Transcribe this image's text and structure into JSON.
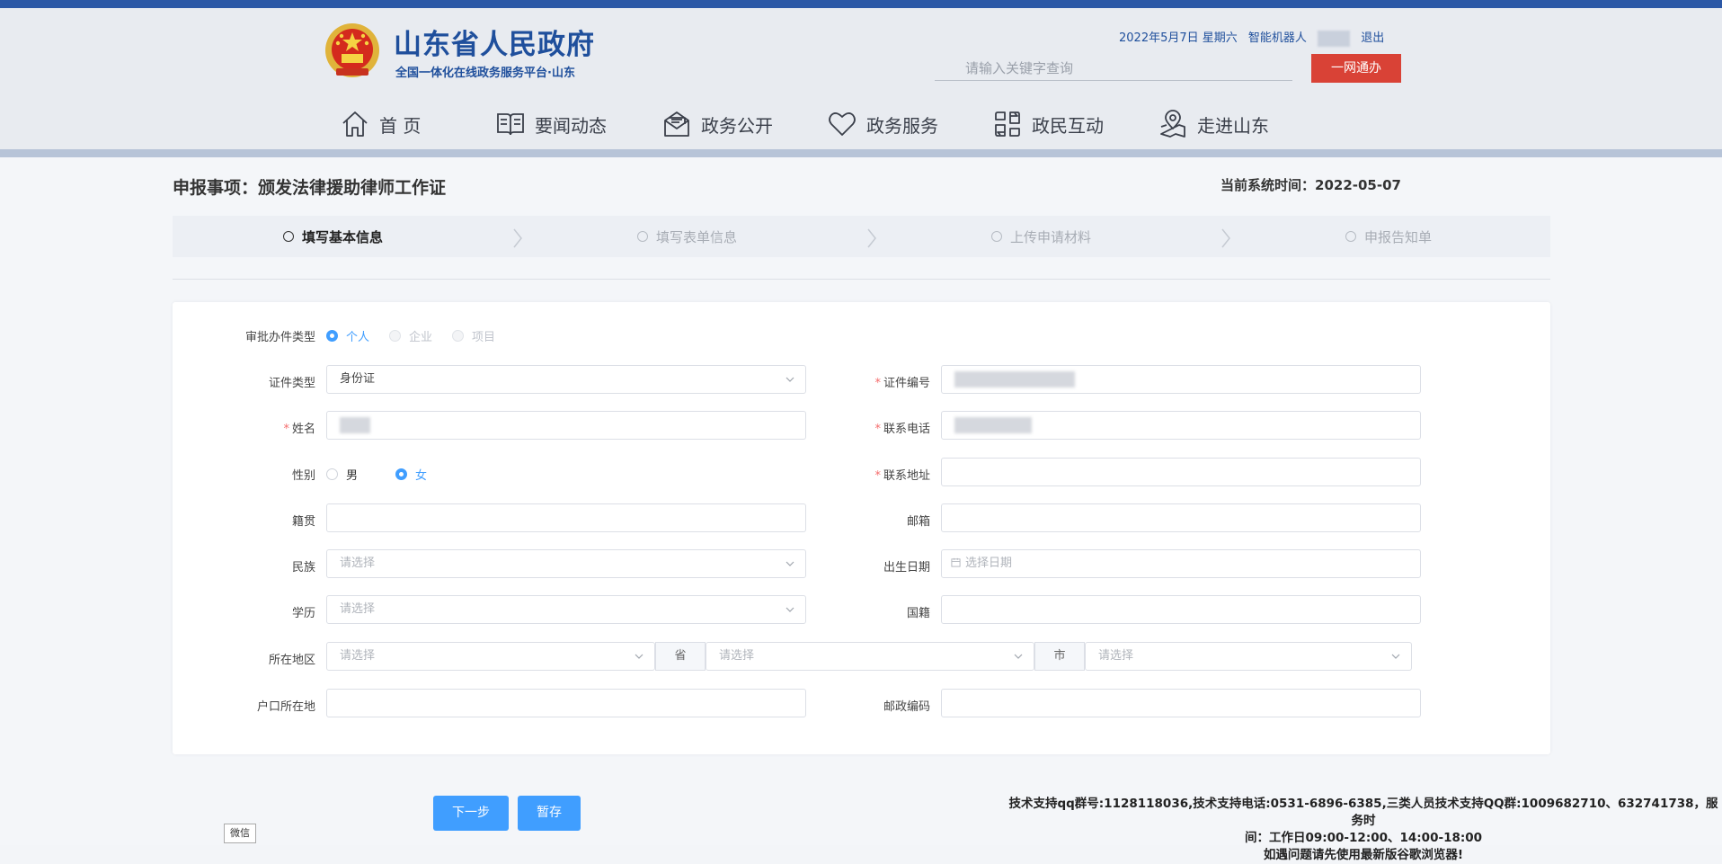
{
  "header": {
    "site_title": "山东省人民政府",
    "site_subtitle": "全国一体化在线政务服务平台·山东",
    "date": "2022年5月7日 星期六",
    "user_label": "智能机器人",
    "logout": "退出",
    "search_placeholder": "请输入关键字查询",
    "yiwang_button": "一网通办"
  },
  "nav": [
    {
      "label": "首 页",
      "icon": "home-icon"
    },
    {
      "label": "要闻动态",
      "icon": "book-icon"
    },
    {
      "label": "政务公开",
      "icon": "mail-icon"
    },
    {
      "label": "政务服务",
      "icon": "heart-icon"
    },
    {
      "label": "政民互动",
      "icon": "exchange-icon"
    },
    {
      "label": "走进山东",
      "icon": "map-pin-icon"
    }
  ],
  "page": {
    "apply_title": "申报事项：颁发法律援助律师工作证",
    "systime_label": "当前系统时间：",
    "systime_value": "2022-05-07"
  },
  "steps": [
    {
      "label": "填写基本信息",
      "active": true
    },
    {
      "label": "填写表单信息",
      "active": false
    },
    {
      "label": "上传申请材料",
      "active": false
    },
    {
      "label": "申报告知单",
      "active": false
    }
  ],
  "form": {
    "type_label": "审批办件类型",
    "type_options": [
      "个人",
      "企业",
      "项目"
    ],
    "id_type_label": "证件类型",
    "id_type_value": "身份证",
    "id_number_label": "证件编号",
    "name_label": "姓名",
    "phone_label": "联系电话",
    "gender_label": "性别",
    "gender_options": [
      "男",
      "女"
    ],
    "address_label": "联系地址",
    "native_label": "籍贯",
    "email_label": "邮箱",
    "ethnicity_label": "民族",
    "ethnicity_placeholder": "请选择",
    "birth_label": "出生日期",
    "birth_placeholder": "选择日期",
    "education_label": "学历",
    "education_placeholder": "请选择",
    "nationality_label": "国籍",
    "region_label": "所在地区",
    "region_placeholder": "请选择",
    "province_addon": "省",
    "city_addon": "市",
    "household_label": "户口所在地",
    "postcode_label": "邮政编码"
  },
  "actions": {
    "next": "下一步",
    "save": "暂存"
  },
  "footer": {
    "support_line1": "技术支持qq群号:1128118036,技术支持电话:0531-6896-6385,三类人员技术支持QQ群:1009682710、632741738，服务时",
    "support_line2": "间：工作日09:00-12:00、14:00-18:00",
    "support_line3": "如遇问题请先使用最新版谷歌浏览器!",
    "wechat_tag": "微信"
  },
  "colors": {
    "brand_blue": "#1f4f9c",
    "accent_red": "#d94236",
    "primary": "#409eff"
  }
}
